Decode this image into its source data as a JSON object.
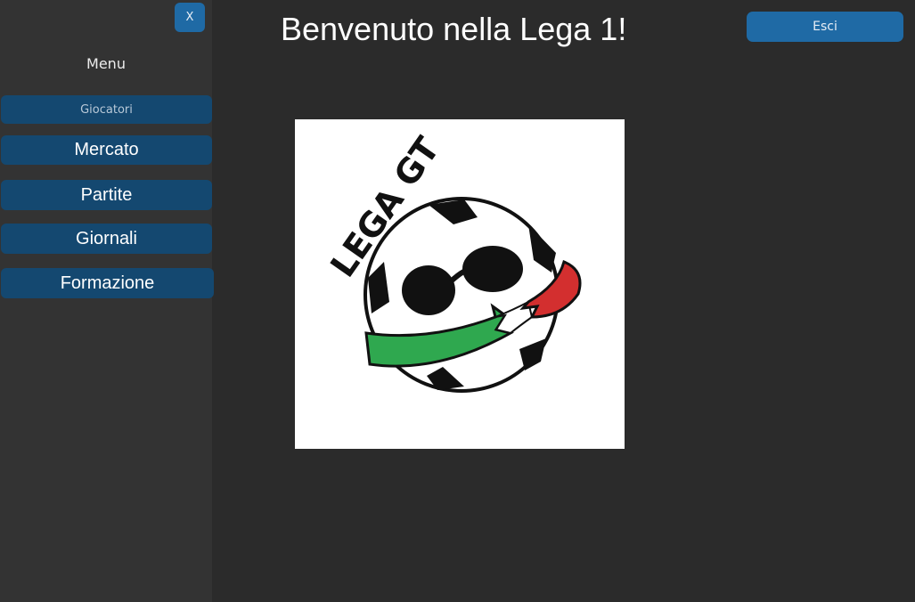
{
  "sidebar": {
    "close_label": "X",
    "menu_label": "Menu",
    "items": [
      {
        "label": "Giocatori"
      },
      {
        "label": "Mercato"
      },
      {
        "label": "Partite"
      },
      {
        "label": "Giornali"
      },
      {
        "label": "Formazione"
      }
    ]
  },
  "header": {
    "title": "Benvenuto nella Lega 1!",
    "logout_label": "Esci"
  },
  "logo": {
    "text": "LEGA GT"
  },
  "colors": {
    "background": "#2b2b2b",
    "sidebar": "#333333",
    "nav_button": "#144870",
    "accent_button": "#1f6aa5",
    "logo_green": "#2fa84f",
    "logo_red": "#d32f2f"
  }
}
